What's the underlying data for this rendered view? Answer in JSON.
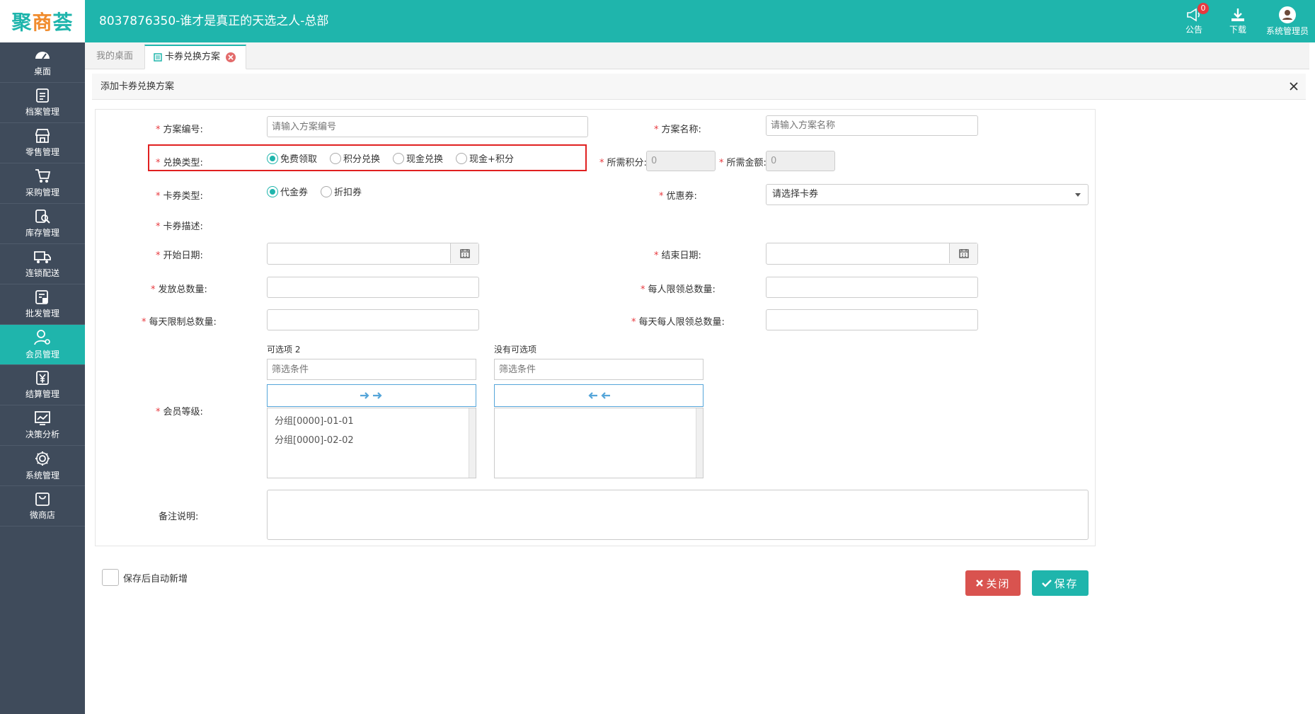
{
  "header": {
    "logo_main": "聚",
    "logo_mid": "商",
    "logo_end": "荟",
    "title": "8037876350-谁才是真正的天选之人-总部",
    "notice_label": "公告",
    "notice_count": "0",
    "download_label": "下载",
    "user_label": "系统管理员"
  },
  "sidebar": {
    "items": [
      {
        "label": "桌面",
        "icon": "dashboard-icon"
      },
      {
        "label": "档案管理",
        "icon": "archive-icon"
      },
      {
        "label": "零售管理",
        "icon": "store-icon"
      },
      {
        "label": "采购管理",
        "icon": "cart-icon"
      },
      {
        "label": "库存管理",
        "icon": "inventory-search-icon"
      },
      {
        "label": "连锁配送",
        "icon": "truck-icon"
      },
      {
        "label": "批发管理",
        "icon": "wholesale-icon"
      },
      {
        "label": "会员管理",
        "icon": "member-icon"
      },
      {
        "label": "结算管理",
        "icon": "yuan-icon"
      },
      {
        "label": "决策分析",
        "icon": "chart-icon"
      },
      {
        "label": "系统管理",
        "icon": "gear-icon"
      },
      {
        "label": "微商店",
        "icon": "shop-bag-icon"
      }
    ],
    "active_index": 7
  },
  "tabs": {
    "home": "我的桌面",
    "current": "卡券兑换方案"
  },
  "panel": {
    "title": "添加卡券兑换方案"
  },
  "form": {
    "scheme_no_label": "方案编号:",
    "scheme_no_placeholder": "请输入方案编号",
    "scheme_name_label": "方案名称:",
    "scheme_name_placeholder": "请输入方案名称",
    "exchange_type_label": "兑换类型:",
    "exchange_options": [
      "免费领取",
      "积分兑换",
      "现金兑换",
      "现金+积分"
    ],
    "exchange_selected": 0,
    "points_label": "所需积分:",
    "points_value": "0",
    "amount_label": "所需金额:",
    "amount_value": "0",
    "card_type_label": "卡券类型:",
    "card_type_options": [
      "代金券",
      "折扣券"
    ],
    "card_type_selected": 0,
    "coupon_label": "优惠券:",
    "coupon_value": "请选择卡券",
    "desc_label": "卡券描述:",
    "start_label": "开始日期:",
    "end_label": "结束日期:",
    "total_label": "发放总数量:",
    "per_person_label": "每人限领总数量:",
    "daily_label": "每天限制总数量:",
    "daily_person_label": "每天每人限领总数量:",
    "member_level_label": "会员等级:",
    "available_title": "可选项 2",
    "selected_title": "没有可选项",
    "filter_placeholder": "筛选条件",
    "available_items": [
      "分组[0000]-01-01",
      "分组[0000]-02-02"
    ],
    "remark_label": "备注说明:"
  },
  "footer": {
    "auto_add_label": "保存后自动新增",
    "close_label": "关闭",
    "save_label": "保存"
  }
}
